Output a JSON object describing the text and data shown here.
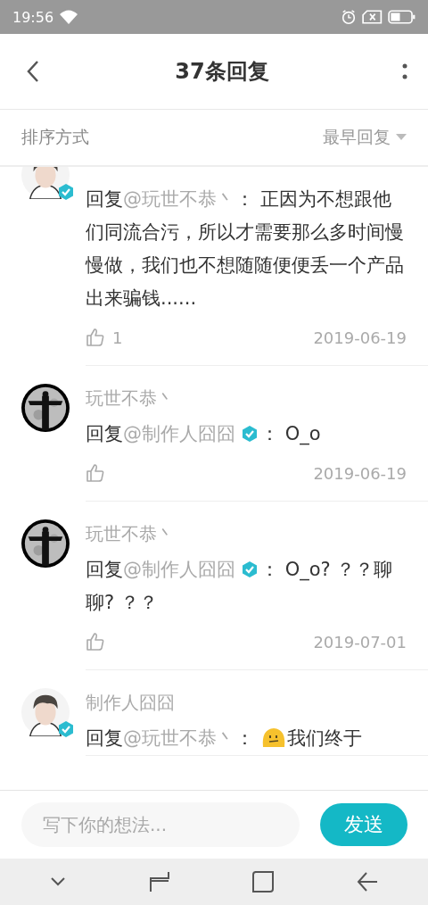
{
  "status_bar": {
    "time": "19:56"
  },
  "header": {
    "title": "37条回复"
  },
  "sort_bar": {
    "label": "排序方式",
    "option": "最早回复"
  },
  "comments": [
    {
      "author": true,
      "body": {
        "prefix": "回复",
        "mention": "@玩世不恭丶",
        "mention_verified": false,
        "segments": [
          {
            "kind": "text",
            "text": "： 正因为不想跟他们同流合污，所以才需要那么多时间慢慢做，我们也不想随随便便丢一个产品出来骗钱......"
          }
        ]
      },
      "likes": "1",
      "date": "2019-06-19"
    },
    {
      "name": "玩世不恭丶",
      "author": false,
      "body": {
        "prefix": "回复",
        "mention": "@制作人囧囧",
        "mention_verified": true,
        "segments": [
          {
            "kind": "text",
            "text": "： O_o"
          }
        ]
      },
      "date": "2019-06-19"
    },
    {
      "name": "玩世不恭丶",
      "author": false,
      "body": {
        "prefix": "回复",
        "mention": "@制作人囧囧",
        "mention_verified": true,
        "segments": [
          {
            "kind": "text",
            "text": "： O_o? ？？聊聊? ？？"
          }
        ]
      },
      "date": "2019-07-01"
    },
    {
      "name": "制作人囧囧",
      "author": true,
      "body": {
        "prefix": "回复",
        "mention": "@玩世不恭丶",
        "mention_verified": false,
        "segments": [
          {
            "kind": "text",
            "text": "： "
          },
          {
            "kind": "emoji"
          },
          {
            "kind": "text",
            "text": "我们终于"
          }
        ]
      }
    }
  ],
  "composer": {
    "placeholder": "写下你的想法...",
    "send": "发送"
  }
}
